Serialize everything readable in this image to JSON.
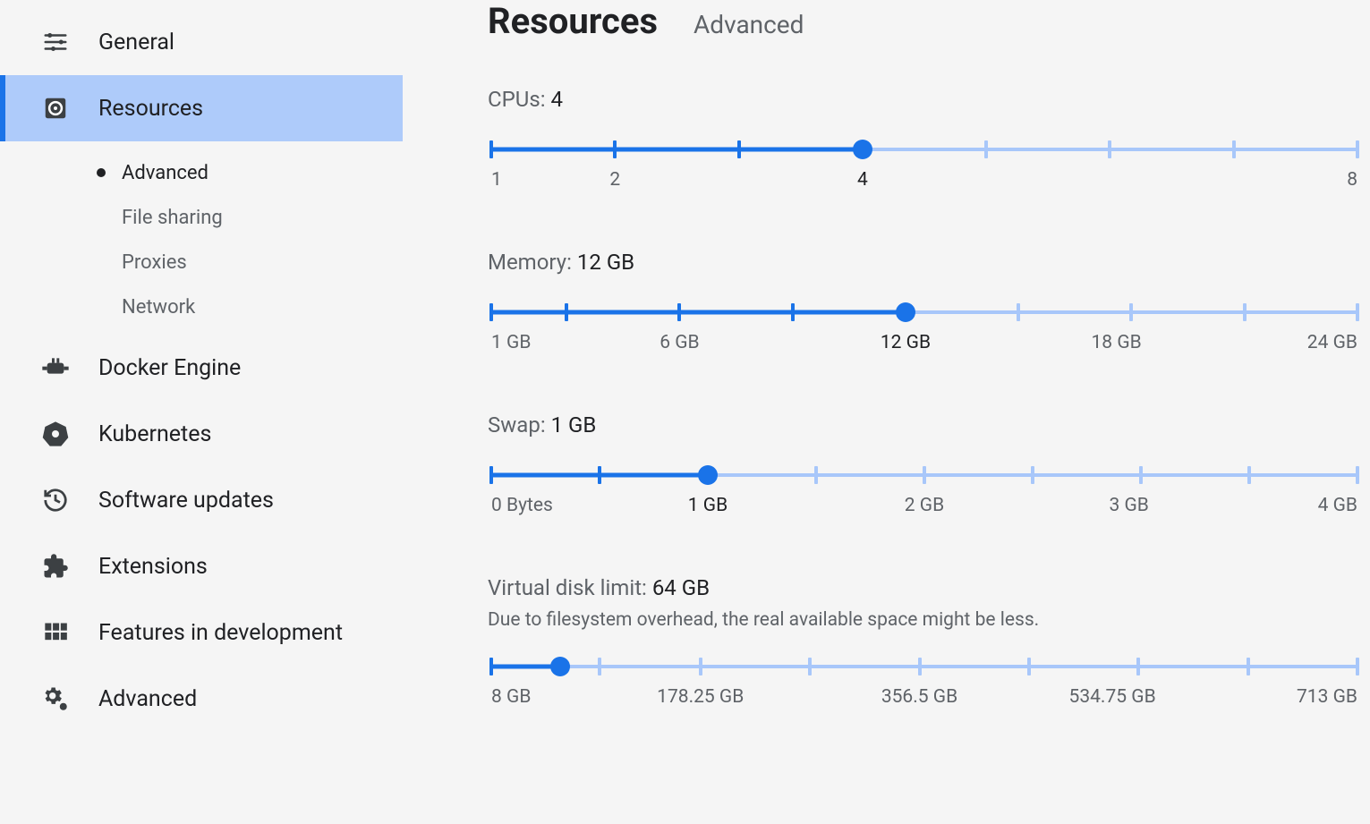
{
  "sidebar": {
    "items": [
      {
        "id": "general",
        "label": "General",
        "icon": "tune"
      },
      {
        "id": "resources",
        "label": "Resources",
        "icon": "disc",
        "selected": true,
        "children": [
          {
            "id": "advanced",
            "label": "Advanced",
            "active": true
          },
          {
            "id": "filesharing",
            "label": "File sharing"
          },
          {
            "id": "proxies",
            "label": "Proxies"
          },
          {
            "id": "network",
            "label": "Network"
          }
        ]
      },
      {
        "id": "engine",
        "label": "Docker Engine",
        "icon": "engine"
      },
      {
        "id": "k8s",
        "label": "Kubernetes",
        "icon": "helm"
      },
      {
        "id": "updates",
        "label": "Software updates",
        "icon": "history"
      },
      {
        "id": "ext",
        "label": "Extensions",
        "icon": "puzzle"
      },
      {
        "id": "dev",
        "label": "Features in development",
        "icon": "grid"
      },
      {
        "id": "adv",
        "label": "Advanced",
        "icon": "gears"
      }
    ]
  },
  "page": {
    "title": "Resources",
    "crumb": "Advanced"
  },
  "settings": {
    "cpus": {
      "label": "CPUs:",
      "value_display": "4",
      "value": 4,
      "min": 1,
      "max": 8,
      "ticks": [
        1,
        2,
        3,
        4,
        5,
        6,
        7,
        8
      ],
      "tick_labels": {
        "1": "1",
        "2": "2",
        "4": "4",
        "8": "8"
      }
    },
    "memory": {
      "label": "Memory:",
      "value_display": "12 GB",
      "value": 12,
      "min": 1,
      "max": 24,
      "ticks": [
        1,
        3,
        6,
        9,
        12,
        15,
        18,
        21,
        24
      ],
      "tick_labels": {
        "1": "1 GB",
        "6": "6 GB",
        "12": "12 GB",
        "18": "18 GB",
        "24": "24 GB"
      }
    },
    "swap": {
      "label": "Swap:",
      "value_display": "1 GB",
      "value": 1,
      "min": 0,
      "max": 4,
      "ticks": [
        0,
        0.5,
        1,
        1.5,
        2,
        2.5,
        3,
        3.5,
        4
      ],
      "tick_labels": {
        "0": "0 Bytes",
        "1": "1 GB",
        "2": "2 GB",
        "3": "3 GB",
        "4": "4 GB"
      }
    },
    "disk": {
      "label": "Virtual disk limit:",
      "value_display": "64 GB",
      "hint": "Due to filesystem overhead, the real available space might be less.",
      "value": 64,
      "min": 8,
      "max": 713,
      "ticks": [
        8,
        96.125,
        178.25,
        267.375,
        356.5,
        445.625,
        534.75,
        623.875,
        713
      ],
      "tick_labels": {
        "8": "8 GB",
        "178.25": "178.25 GB",
        "356.5": "356.5 GB",
        "534.75": "534.75 GB",
        "713": "713 GB"
      }
    }
  }
}
